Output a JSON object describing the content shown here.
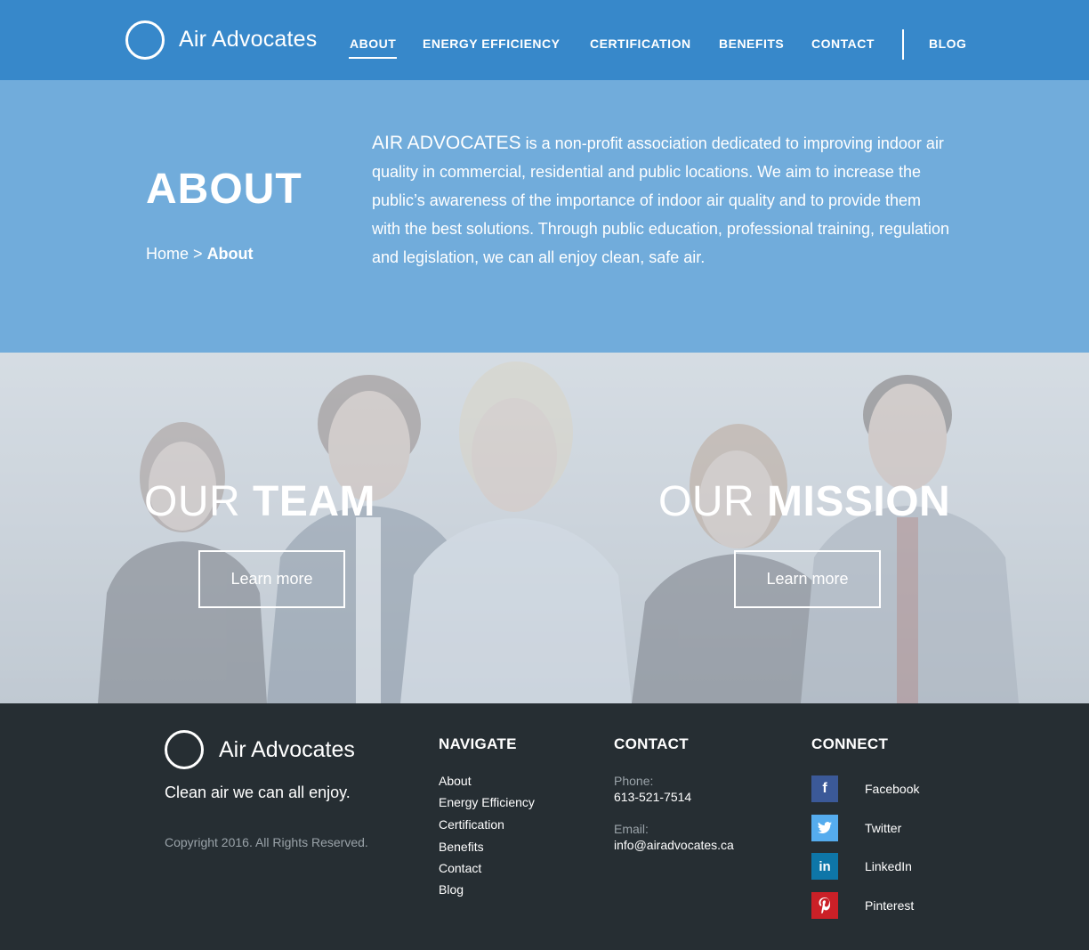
{
  "header": {
    "logo_text": "Air Advocates",
    "nav": [
      "ABOUT",
      "ENERGY EFFICIENCY",
      "CERTIFICATION",
      "BENEFITS",
      "CONTACT",
      "BLOG"
    ],
    "active_nav": "ABOUT"
  },
  "hero": {
    "title": "ABOUT",
    "breadcrumb_home": "Home",
    "breadcrumb_sep": ">",
    "breadcrumb_current": "About",
    "org_name": "AIR ADVOCATES",
    "body": "is a non-profit association dedicated to improving indoor air quality in commercial, residential and public locations. We aim to increase the public’s awareness of the importance of indoor air quality and to provide them with the best solutions. Through public education, professional training, regulation and legislation, we can all enjoy clean, safe air."
  },
  "team": {
    "heading_light": "OUR",
    "heading_bold": "TEAM",
    "button": "Learn more"
  },
  "mission": {
    "heading_light": "OUR",
    "heading_bold": "MISSION",
    "button": "Learn more"
  },
  "footer": {
    "logo_text": "Air Advocates",
    "tagline": "Clean air we can all enjoy.",
    "copyright": "Copyright 2016. All Rights Reserved.",
    "navigate": {
      "heading": "NAVIGATE",
      "links": [
        "About",
        "Energy Efficiency",
        "Certification",
        "Benefits",
        "Contact",
        "Blog"
      ]
    },
    "contact": {
      "heading": "CONTACT",
      "phone_label": "Phone:",
      "phone": "613-521-7514",
      "email_label": "Email:",
      "email": "info@airadvocates.ca"
    },
    "connect": {
      "heading": "CONNECT",
      "items": [
        {
          "label": "Facebook",
          "icon": "facebook-icon",
          "glyph": "f",
          "color": "#3b5998"
        },
        {
          "label": "Twitter",
          "icon": "twitter-icon",
          "glyph": "t",
          "color": "#55acee"
        },
        {
          "label": "LinkedIn",
          "icon": "linkedin-icon",
          "glyph": "in",
          "color": "#0e76a8"
        },
        {
          "label": "Pinterest",
          "icon": "pinterest-icon",
          "glyph": "P",
          "color": "#cb2027"
        }
      ]
    }
  },
  "colors": {
    "header_bg": "#3788ca",
    "hero_bg": "#71acdb",
    "footer_bg": "#262e33"
  }
}
